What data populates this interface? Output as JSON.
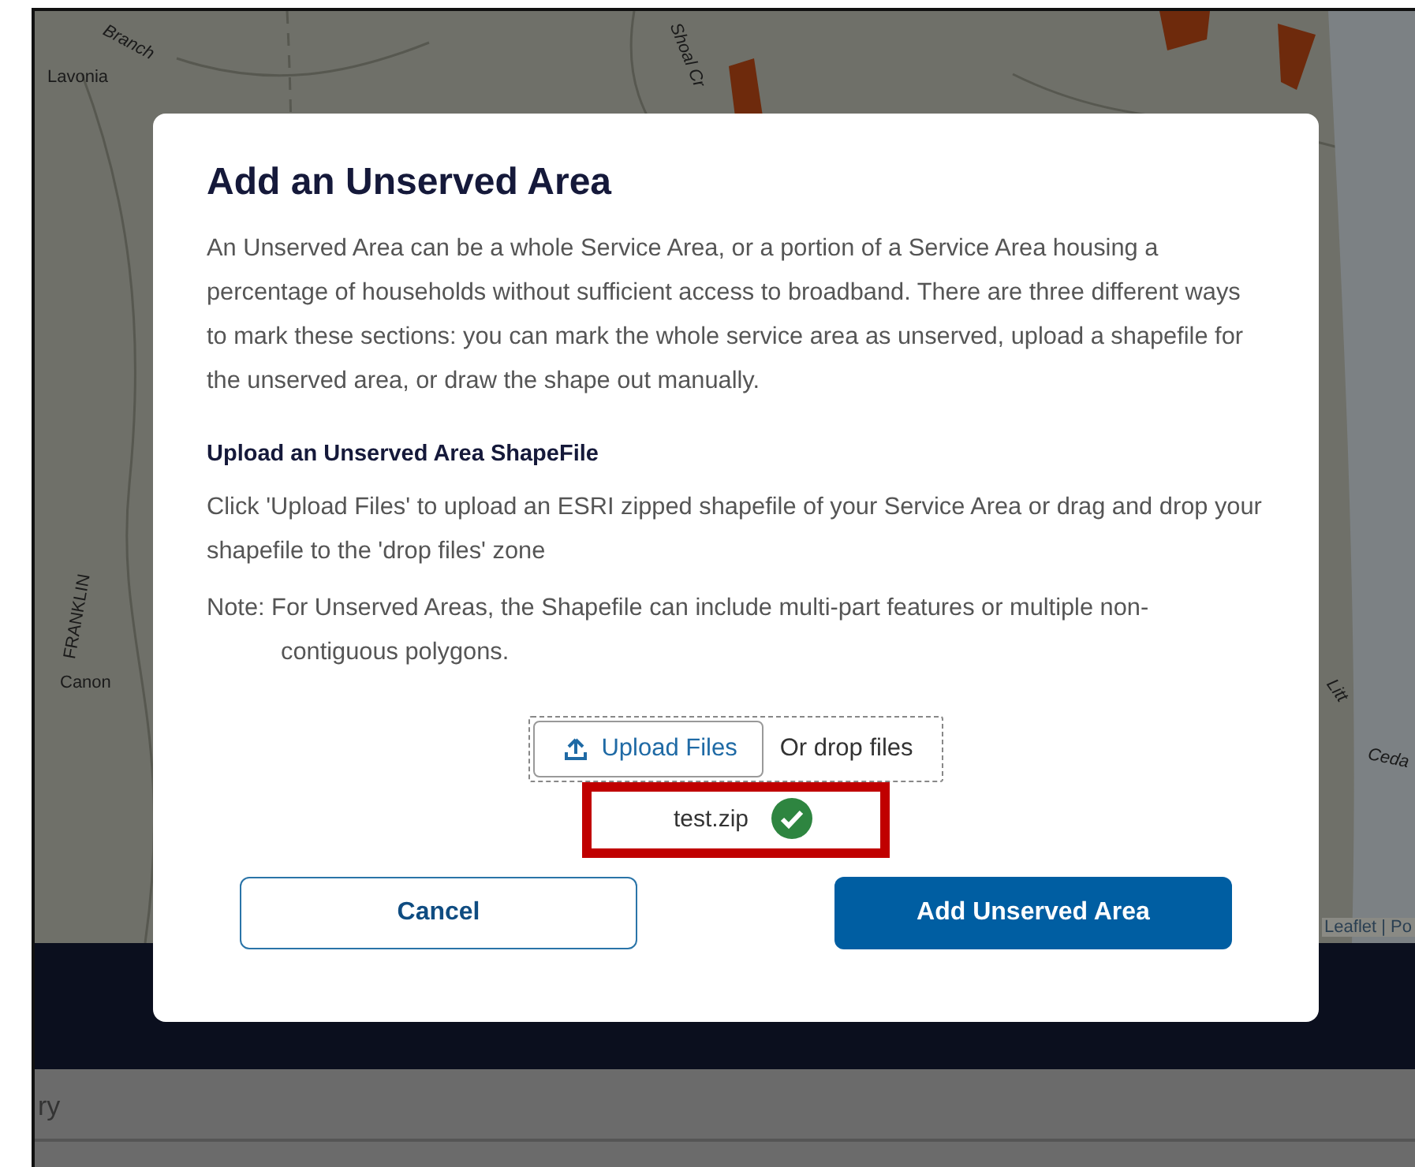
{
  "map": {
    "labels": [
      {
        "text": "Lavonia"
      },
      {
        "text": "Branch"
      },
      {
        "text": "Shoal Cr"
      },
      {
        "text": "FRANKLIN"
      },
      {
        "text": "Canon"
      },
      {
        "text": "Litt"
      },
      {
        "text": "Ceda"
      }
    ],
    "attribution": "Leaflet | Po"
  },
  "footer": {
    "text": "ry"
  },
  "dialog": {
    "title": "Add an Unserved Area",
    "description": "An Unserved Area can be a whole Service Area, or a portion of a Service Area housing a percentage of households without sufficient access to broadband. There are three different ways to mark these sections: you can mark the whole service area as unserved, upload a shapefile for the unserved area, or draw the shape out manually.",
    "section_title": "Upload an Unserved Area ShapeFile",
    "instructions": "Click 'Upload Files' to upload an ESRI zipped shapefile of your Service Area or drag and drop your shapefile to the 'drop files' zone",
    "note": "Note: For Unserved Areas, the Shapefile can include multi-part features or multiple non-contiguous polygons.",
    "upload": {
      "button": "Upload Files",
      "drop_text": "Or drop files"
    },
    "files": [
      {
        "name": "test.zip",
        "uploaded": true,
        "highlighted": true
      }
    ],
    "buttons": [
      {
        "label": "Cancel",
        "kind": "secondary"
      },
      {
        "label": "Add Unserved Area",
        "kind": "primary"
      }
    ]
  }
}
